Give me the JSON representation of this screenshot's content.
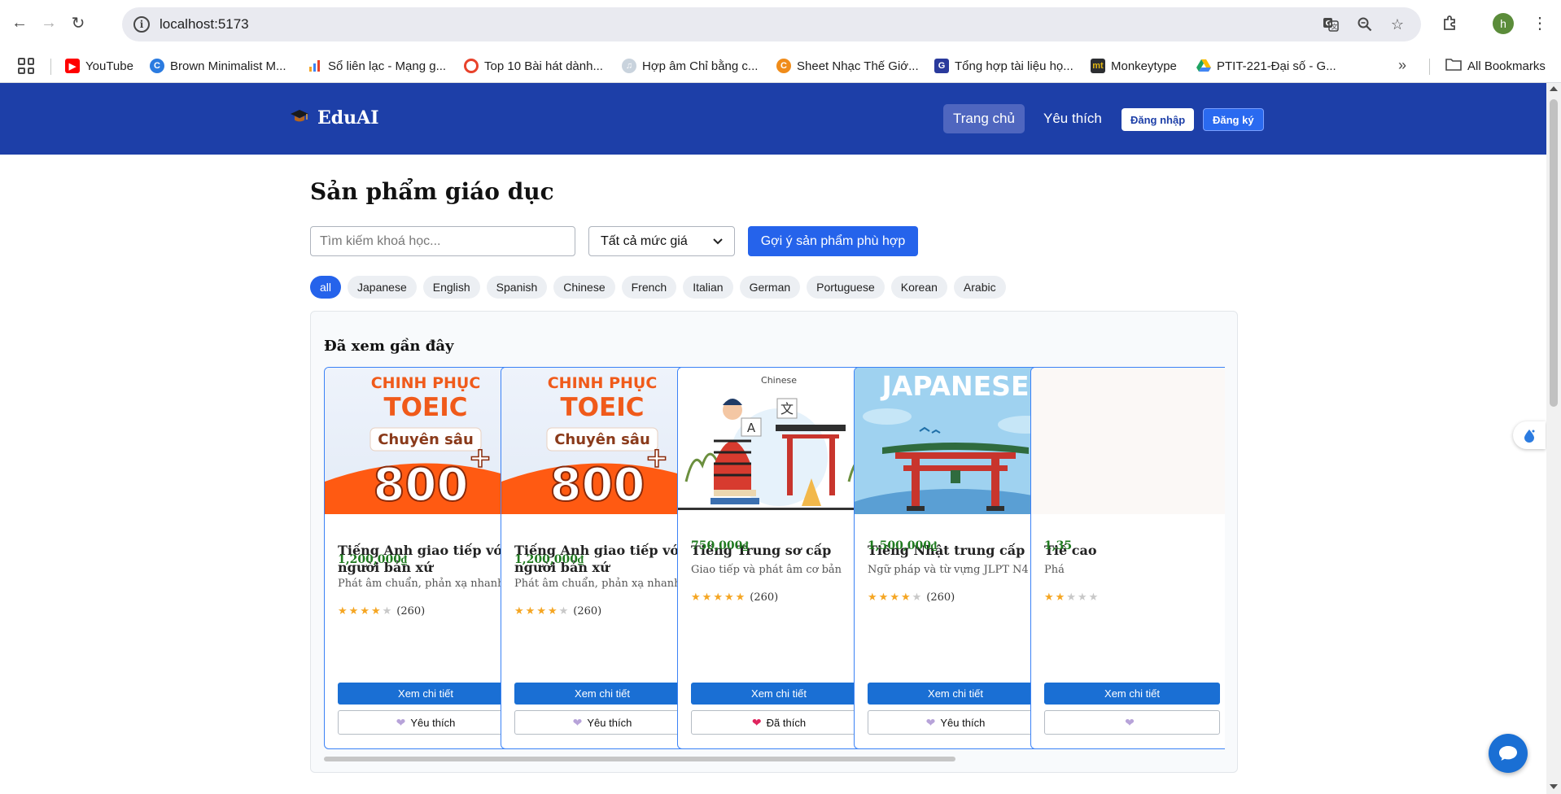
{
  "browser": {
    "url": "localhost:5173",
    "profile_initial": "h",
    "bookmarks": [
      {
        "label": "YouTube",
        "icon": "youtube-icon",
        "color": "#ff0000"
      },
      {
        "label": "Brown Minimalist M...",
        "icon": "canva-icon",
        "color": "#2b7be0"
      },
      {
        "label": "Sổ liên lạc - Mạng g...",
        "icon": "chart-icon",
        "color": "#f5a623"
      },
      {
        "label": "Top 10 Bài hát dành...",
        "icon": "circle-icon",
        "color": "#e8422b"
      },
      {
        "label": "Hợp âm Chỉ bằng c...",
        "icon": "music-icon",
        "color": "#8899aa"
      },
      {
        "label": "Sheet Nhạc Thế Giớ...",
        "icon": "sheet-icon",
        "color": "#f08c1a"
      },
      {
        "label": "Tổng hợp tài liệu họ...",
        "icon": "doc-icon",
        "color": "#2a3a9c"
      },
      {
        "label": "Monkeytype",
        "icon": "monkeytype-icon",
        "color": "#2c2e31"
      },
      {
        "label": "PTIT-221-Đại số - G...",
        "icon": "drive-icon",
        "color": "#1ea362"
      }
    ],
    "all_bookmarks_label": "All Bookmarks"
  },
  "header": {
    "brand": "EduAI",
    "nav": [
      {
        "label": "Trang chủ",
        "active": true
      },
      {
        "label": "Yêu thích",
        "active": false
      }
    ],
    "login_label": "Đăng nhập",
    "register_label": "Đăng ký"
  },
  "main": {
    "title": "Sản phẩm giáo dục",
    "search_placeholder": "Tìm kiếm khoá học...",
    "price_filter": "Tất cả mức giá",
    "suggest_button": "Gợi ý sản phẩm phù hợp",
    "categories": [
      "all",
      "Japanese",
      "English",
      "Spanish",
      "Chinese",
      "French",
      "Italian",
      "German",
      "Portuguese",
      "Korean",
      "Arabic"
    ],
    "active_category": "all"
  },
  "recent": {
    "title": "Đã xem gần đây",
    "detail_label": "Xem chi tiết",
    "cards": [
      {
        "image": "toeic-banner",
        "image_text": {
          "line1": "CHINH PHỤC",
          "line2": "TOEIC",
          "line3": "Chuyên sâu",
          "line4": "800",
          "plus": "+"
        },
        "title": "Tiếng Anh giao tiếp với người bản xứ",
        "price": "1,200,000₫",
        "description": "Phát âm chuẩn, phản xạ nhanh",
        "rating": 4,
        "reviews": "(260)",
        "fav_label": "Yêu thích",
        "favorited": false
      },
      {
        "image": "toeic-banner",
        "image_text": {
          "line1": "CHINH PHỤC",
          "line2": "TOEIC",
          "line3": "Chuyên sâu",
          "line4": "800",
          "plus": "+"
        },
        "title": "Tiếng Anh giao tiếp với người bản xứ",
        "price": "1,200,000₫",
        "description": "Phát âm chuẩn, phản xạ nhanh",
        "rating": 4,
        "reviews": "(260)",
        "fav_label": "Yêu thích",
        "favorited": false
      },
      {
        "image": "chinese-illustration",
        "image_text": {
          "label": "Chinese",
          "glyph": "文",
          "letter": "A"
        },
        "title": "Tiếng Trung sơ cấp",
        "price": "750,000₫",
        "description": "Giao tiếp và phát âm cơ bản",
        "rating": 5,
        "reviews": "(260)",
        "fav_label": "Đã thích",
        "favorited": true
      },
      {
        "image": "japanese-torii",
        "image_text": {
          "label": "JAPANESE"
        },
        "title": "Tiếng Nhật trung cấp",
        "price": "1,500,000₫",
        "description": "Ngữ pháp và từ vựng JLPT N4",
        "rating": 4,
        "reviews": "(260)",
        "fav_label": "Yêu thích",
        "favorited": false
      },
      {
        "image": "blank",
        "title": "Tiế cao",
        "price": "1,35",
        "description": "Phá",
        "rating": 2,
        "reviews": "",
        "fav_label": "",
        "favorited": false
      }
    ]
  },
  "colors": {
    "header_bg": "#1d3fa8",
    "primary": "#2563eb",
    "price_green": "#1f7a1f",
    "star": "#f5a623"
  }
}
